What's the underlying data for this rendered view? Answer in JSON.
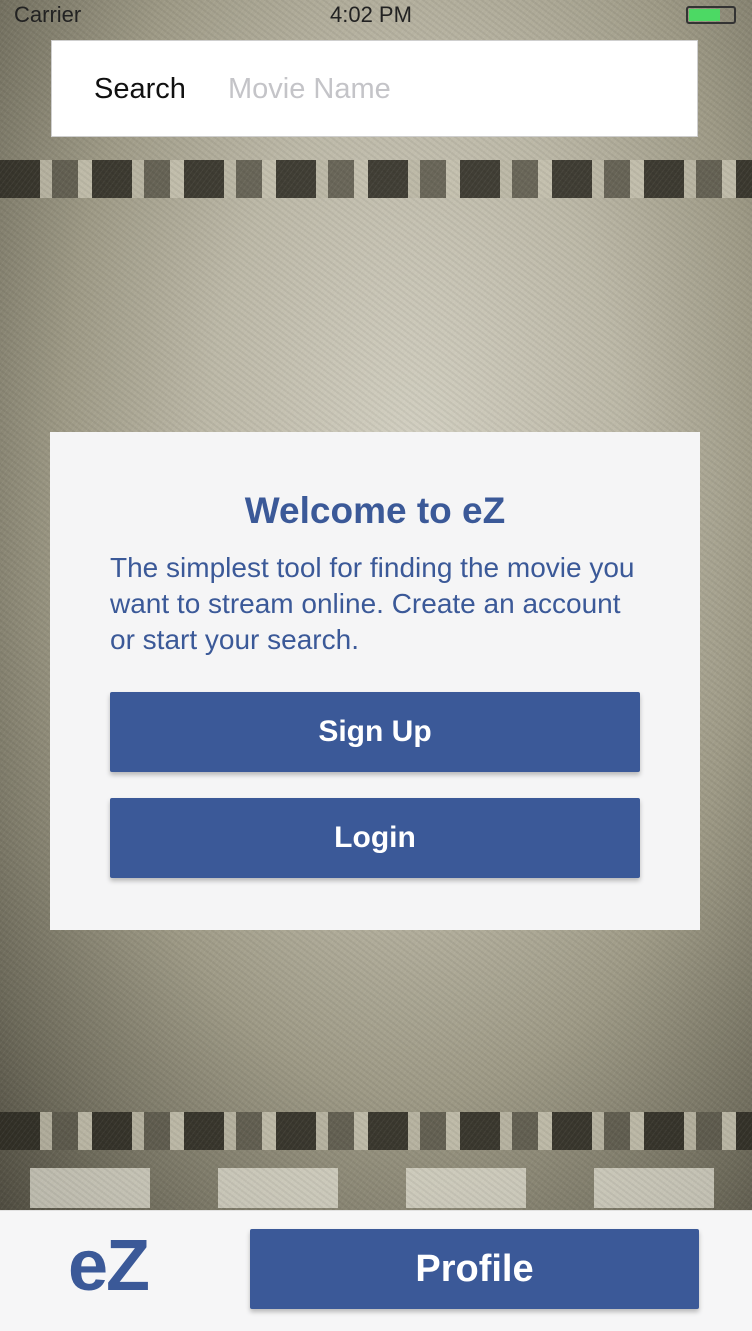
{
  "status_bar": {
    "carrier": "Carrier",
    "time": "4:02 PM",
    "battery_level": 0.7
  },
  "search": {
    "label": "Search",
    "placeholder": "Movie Name",
    "value": ""
  },
  "welcome": {
    "title": "Welcome to eZ",
    "body": "The simplest tool for finding the movie you want to stream online. Create an account or start your search.",
    "signup_label": "Sign Up",
    "login_label": "Login"
  },
  "bottom_bar": {
    "logo": "eZ",
    "profile_label": "Profile"
  },
  "colors": {
    "brand": "#3b5998",
    "card_bg": "#f5f5f6",
    "battery": "#4cd964"
  }
}
